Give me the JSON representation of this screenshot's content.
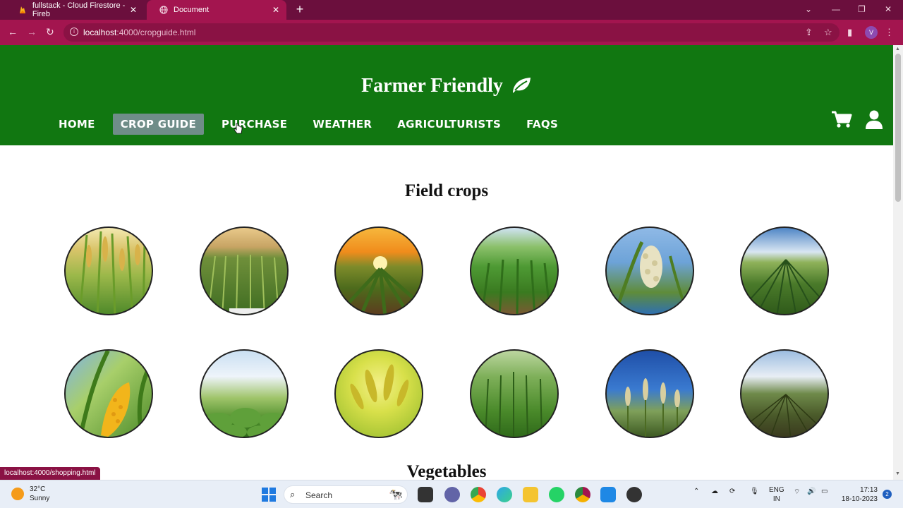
{
  "browser": {
    "tabs": [
      {
        "title": "fullstack - Cloud Firestore - Fireb",
        "active": false
      },
      {
        "title": "Document",
        "active": true
      }
    ],
    "url_host": "localhost",
    "url_path": ":4000/cropguide.html",
    "profile_initial": "V",
    "status_url": "localhost:4000/shopping.html"
  },
  "site": {
    "brand": "Farmer Friendly",
    "nav": [
      {
        "label": "HOME",
        "active": false
      },
      {
        "label": "CROP GUIDE",
        "active": true
      },
      {
        "label": "PURCHASE",
        "active": false
      },
      {
        "label": "WEATHER",
        "active": false
      },
      {
        "label": "AGRICULTURISTS",
        "active": false
      },
      {
        "label": "FAQS",
        "active": false
      }
    ],
    "header_color": "#117711",
    "sections": [
      {
        "title": "Field crops"
      },
      {
        "title": "Vegetables"
      }
    ]
  },
  "taskbar": {
    "weather_temp": "32°C",
    "weather_desc": "Sunny",
    "search_label": "Search",
    "lang_1": "ENG",
    "lang_2": "IN",
    "time": "17:13",
    "date": "18-10-2023",
    "notif_count": "2"
  }
}
